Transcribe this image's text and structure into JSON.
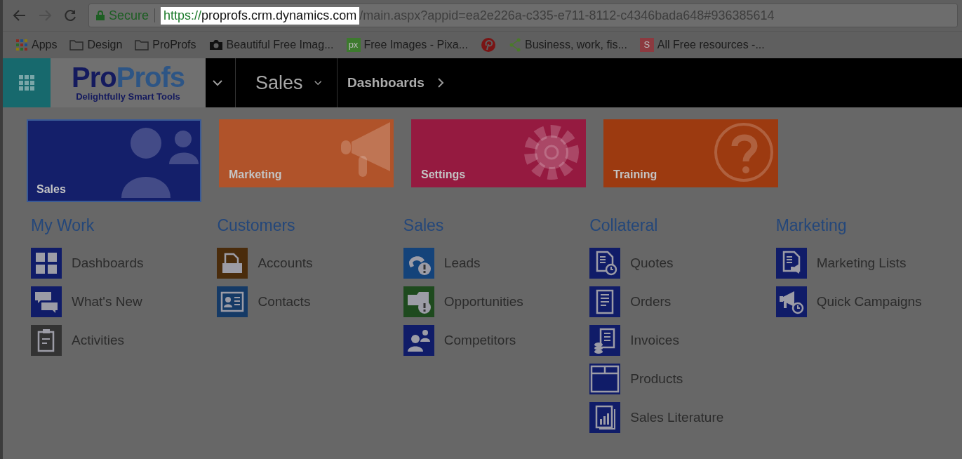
{
  "browser": {
    "security": "Secure",
    "url_scheme": "https://",
    "url_host": "proprofs.crm.dynamics.com",
    "url_rest": "/main.aspx?appid=ea2e226a-c335-e711-8112-c4346bada648#936385614",
    "forward_disabled": true
  },
  "bookmarks": [
    {
      "kind": "apps",
      "label": "Apps"
    },
    {
      "kind": "folder",
      "label": "Design"
    },
    {
      "kind": "folder",
      "label": "ProProfs"
    },
    {
      "kind": "camera",
      "label": "Beautiful Free Imag..."
    },
    {
      "kind": "badge",
      "badge": "px",
      "color": "#3d7a2e",
      "label": "Free Images - Pixa..."
    },
    {
      "kind": "pin"
    },
    {
      "kind": "share",
      "label": "Business, work, fis..."
    },
    {
      "kind": "badge",
      "badge": "S",
      "color": "#8c3a40",
      "label": "All Free resources -..."
    }
  ],
  "nav": {
    "logo": {
      "parts": [
        {
          "text": "Pro",
          "color": "#141a5e"
        },
        {
          "text": "Profs",
          "color": "#2d5585"
        }
      ],
      "tagline": "Delightfully Smart Tools"
    },
    "area": "Sales",
    "breadcrumb": "Dashboards"
  },
  "tiles": [
    {
      "label": "Sales",
      "color": "#141f6a",
      "selected": true
    },
    {
      "label": "Marketing",
      "color": "#b0532a",
      "selected": false
    },
    {
      "label": "Settings",
      "color": "#951a40",
      "selected": false
    },
    {
      "label": "Training",
      "color": "#9c3a10",
      "selected": false
    }
  ],
  "columns": [
    {
      "heading": "My Work",
      "items": [
        {
          "label": "Dashboards",
          "color": "#101c68"
        },
        {
          "label": "What's New",
          "color": "#101c68"
        },
        {
          "label": "Activities",
          "color": "#333333"
        }
      ]
    },
    {
      "heading": "Customers",
      "items": [
        {
          "label": "Accounts",
          "color": "#4a2c0c"
        },
        {
          "label": "Contacts",
          "color": "#153a66"
        }
      ]
    },
    {
      "heading": "Sales",
      "items": [
        {
          "label": "Leads",
          "color": "#14437a"
        },
        {
          "label": "Opportunities",
          "color": "#1e4a1e"
        },
        {
          "label": "Competitors",
          "color": "#101c68"
        }
      ]
    },
    {
      "heading": "Collateral",
      "items": [
        {
          "label": "Quotes",
          "color": "#101c68"
        },
        {
          "label": "Orders",
          "color": "#101c68"
        },
        {
          "label": "Invoices",
          "color": "#101c68"
        },
        {
          "label": "Products",
          "color": "#101c68"
        },
        {
          "label": "Sales Literature",
          "color": "#101c68"
        }
      ]
    },
    {
      "heading": "Marketing",
      "items": [
        {
          "label": "Marketing Lists",
          "color": "#101c68"
        },
        {
          "label": "Quick Campaigns",
          "color": "#101c68"
        }
      ]
    }
  ]
}
